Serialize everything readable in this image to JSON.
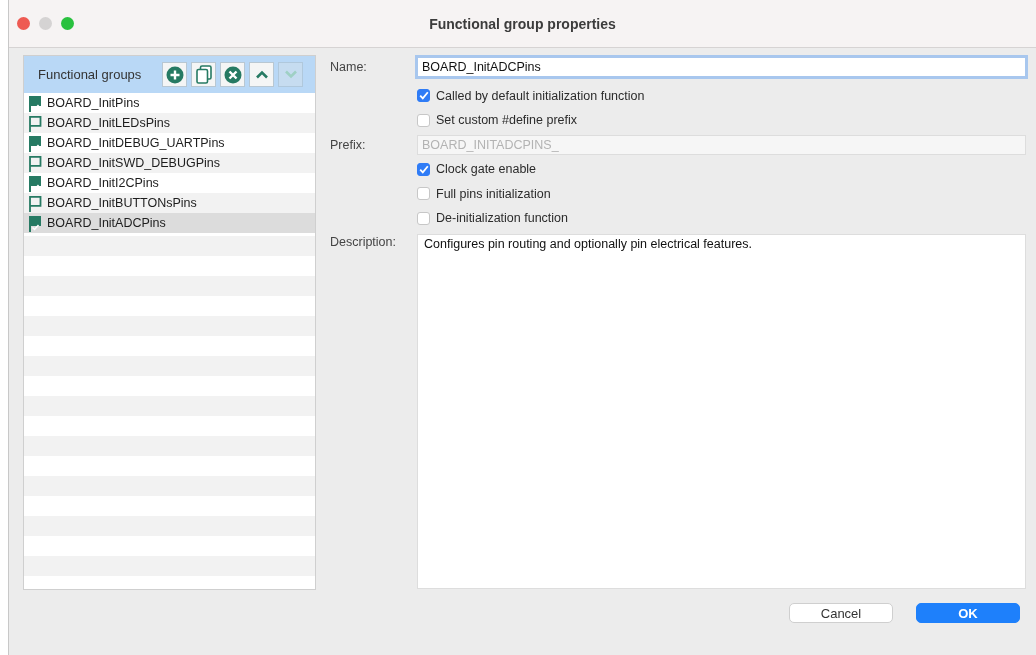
{
  "window": {
    "title": "Functional group properties"
  },
  "groups_panel": {
    "title": "Functional groups",
    "toolbar": [
      {
        "kind": "add",
        "disabled": false
      },
      {
        "kind": "copy",
        "disabled": false
      },
      {
        "kind": "remove",
        "disabled": false
      },
      {
        "kind": "up",
        "disabled": false
      },
      {
        "kind": "down",
        "disabled": true
      }
    ],
    "items": [
      {
        "label": "BOARD_InitPins",
        "checked": true,
        "selected": false
      },
      {
        "label": "BOARD_InitLEDsPins",
        "checked": false,
        "selected": false
      },
      {
        "label": "BOARD_InitDEBUG_UARTPins",
        "checked": true,
        "selected": false
      },
      {
        "label": "BOARD_InitSWD_DEBUGPins",
        "checked": false,
        "selected": false
      },
      {
        "label": "BOARD_InitI2CPins",
        "checked": true,
        "selected": false
      },
      {
        "label": "BOARD_InitBUTTONsPins",
        "checked": false,
        "selected": false
      },
      {
        "label": "BOARD_InitADCPins",
        "checked": true,
        "selected": true
      }
    ]
  },
  "form": [
    {
      "kind": "text",
      "label": "Name:",
      "value": "BOARD_InitADCPins",
      "focused": true
    },
    {
      "kind": "checkbox",
      "label": "Called by default initialization function",
      "checked": true
    },
    {
      "kind": "checkbox",
      "label": "Set custom #define prefix",
      "checked": false
    },
    {
      "kind": "text",
      "label": "Prefix:",
      "value": "BOARD_INITADCPINS_",
      "disabled": true
    },
    {
      "kind": "checkbox",
      "label": "Clock gate enable",
      "checked": true
    },
    {
      "kind": "checkbox",
      "label": "Full pins initialization",
      "checked": false
    },
    {
      "kind": "checkbox",
      "label": "De-initialization function",
      "checked": false
    },
    {
      "kind": "textarea",
      "label": "Description:",
      "value": "Configures pin routing and optionally pin electrical features."
    }
  ],
  "buttons": [
    {
      "label": "Cancel",
      "primary": false
    },
    {
      "label": "OK",
      "primary": true
    }
  ]
}
